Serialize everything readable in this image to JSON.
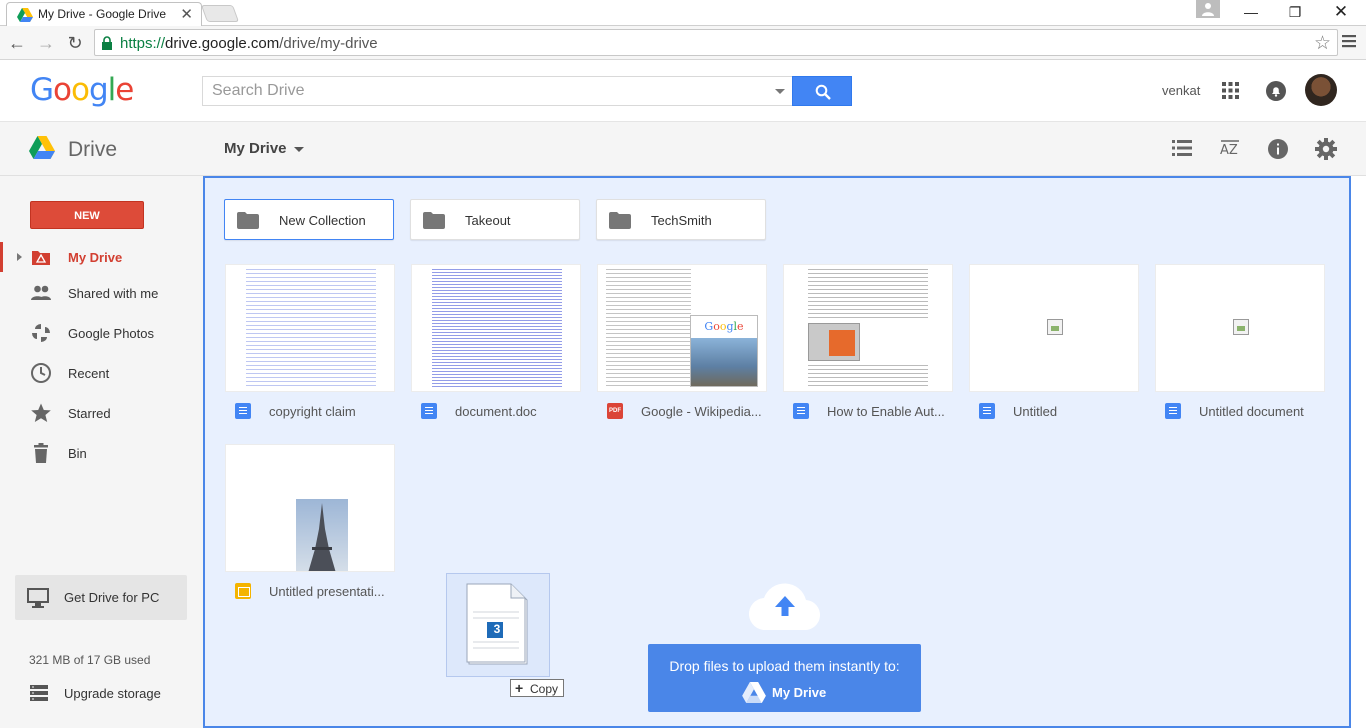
{
  "browser": {
    "tab_title": "My Drive - Google Drive",
    "url_scheme": "https://",
    "url_host": "drive.google.com",
    "url_path": "/drive/my-drive"
  },
  "header": {
    "logo_letters": [
      "G",
      "o",
      "o",
      "g",
      "l",
      "e"
    ],
    "logo_colors": [
      "#4285f4",
      "#ea4335",
      "#fbbc05",
      "#4285f4",
      "#34a853",
      "#ea4335"
    ],
    "search_placeholder": "Search Drive",
    "user_name": "venkat"
  },
  "drivebar": {
    "app_title": "Drive",
    "breadcrumb": "My Drive"
  },
  "sidebar": {
    "new_label": "NEW",
    "items": [
      {
        "label": "My Drive",
        "icon": "my-drive-icon",
        "active": true
      },
      {
        "label": "Shared with me",
        "icon": "people-icon"
      },
      {
        "label": "Google Photos",
        "icon": "photos-icon"
      },
      {
        "label": "Recent",
        "icon": "clock-icon"
      },
      {
        "label": "Starred",
        "icon": "star-icon"
      },
      {
        "label": "Bin",
        "icon": "trash-icon"
      }
    ],
    "get_drive_label": "Get Drive for PC",
    "storage_text": "321 MB of 17 GB used",
    "upgrade_label": "Upgrade storage"
  },
  "folders": [
    {
      "name": "New Collection",
      "selected": true
    },
    {
      "name": "Takeout"
    },
    {
      "name": "TechSmith"
    }
  ],
  "files": [
    {
      "name": "copyright claim",
      "type": "doc"
    },
    {
      "name": "document.doc",
      "type": "doc"
    },
    {
      "name": "Google - Wikipedia...",
      "type": "pdf",
      "type_label": "PDF"
    },
    {
      "name": "How to Enable Aut...",
      "type": "doc"
    },
    {
      "name": "Untitled",
      "type": "doc"
    },
    {
      "name": "Untitled document",
      "type": "doc"
    },
    {
      "name": "Untitled presentati...",
      "type": "slides"
    }
  ],
  "drag": {
    "badge_count": "3",
    "copy_label": "Copy"
  },
  "drop_banner": {
    "text": "Drop files to upload them instantly to:",
    "destination": "My Drive"
  },
  "colors": {
    "accent": "#4285f4",
    "new_button": "#dd4b39",
    "drop_zone": "#e8f0fe",
    "drop_border": "#4a86e8"
  }
}
